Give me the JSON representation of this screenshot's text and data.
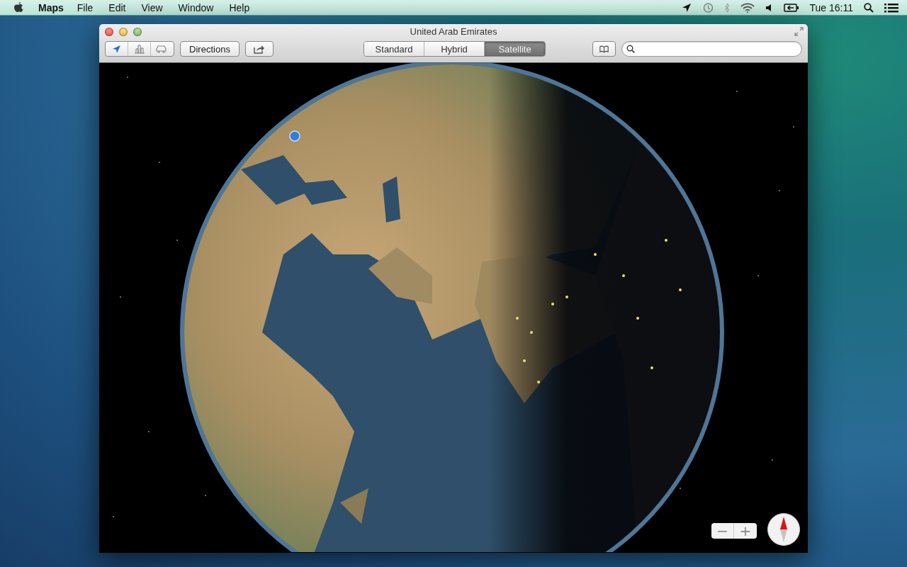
{
  "menu_bar": {
    "app_name": "Maps",
    "menus": [
      "File",
      "Edit",
      "View",
      "Window",
      "Help"
    ],
    "clock": "Tue 16:11"
  },
  "window": {
    "title": "United Arab Emirates"
  },
  "toolbar": {
    "location_tracking": true,
    "directions_label": "Directions",
    "map_modes": [
      {
        "label": "Standard",
        "selected": false
      },
      {
        "label": "Hybrid",
        "selected": false
      },
      {
        "label": "Satellite",
        "selected": true
      }
    ]
  },
  "map_controls": {
    "zoom_out": "−",
    "zoom_in": "+"
  }
}
